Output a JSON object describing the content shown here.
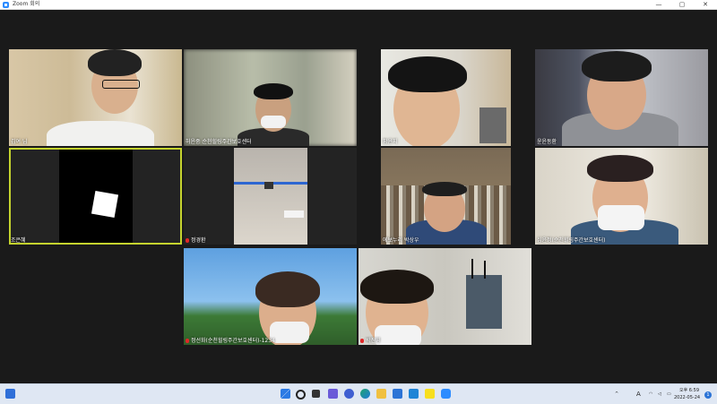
{
  "window": {
    "title": "Zoom 회의",
    "controls": [
      "—",
      "▢",
      "✕"
    ]
  },
  "participants": [
    {
      "id": "p1",
      "name": "김여 님",
      "mic_muted": false
    },
    {
      "id": "p2",
      "name": "허윤중 순천힐링주간보호센터",
      "mic_muted": false
    },
    {
      "id": "p3",
      "name": "황윤지",
      "mic_muted": false
    },
    {
      "id": "p4",
      "name": "윤윤동환",
      "mic_muted": false
    },
    {
      "id": "p5",
      "name": "조은혜",
      "mic_muted": false,
      "active_speaker": true
    },
    {
      "id": "p6",
      "name": "정경환",
      "mic_muted": true
    },
    {
      "id": "p7",
      "name": "에보누리 박상우",
      "mic_muted": false
    },
    {
      "id": "p8",
      "name": "심윤정(순천힐링주간보호센터)",
      "mic_muted": false
    },
    {
      "id": "p9",
      "name": "정선화(순천힐링주간보호센터)-1234",
      "mic_muted": true
    },
    {
      "id": "p10",
      "name": "박진영",
      "mic_muted": true
    }
  ],
  "taskbar": {
    "apps": [
      "start-icon",
      "search-icon",
      "task-view-icon",
      "widgets-icon",
      "chat-icon",
      "edge-icon",
      "file-explorer-icon",
      "store-icon",
      "mail-icon",
      "kakaotalk-icon",
      "zoom-icon"
    ],
    "tray": {
      "language": "A",
      "time": "오후 6:59",
      "date": "2022-05-24",
      "notification_count": "1"
    }
  },
  "colors": {
    "active_border": "#c5d42e",
    "background": "#1a1a1a",
    "taskbar": "#dfe7f3",
    "zoom_blue": "#2d8cff",
    "mic_muted": "#e02828"
  }
}
